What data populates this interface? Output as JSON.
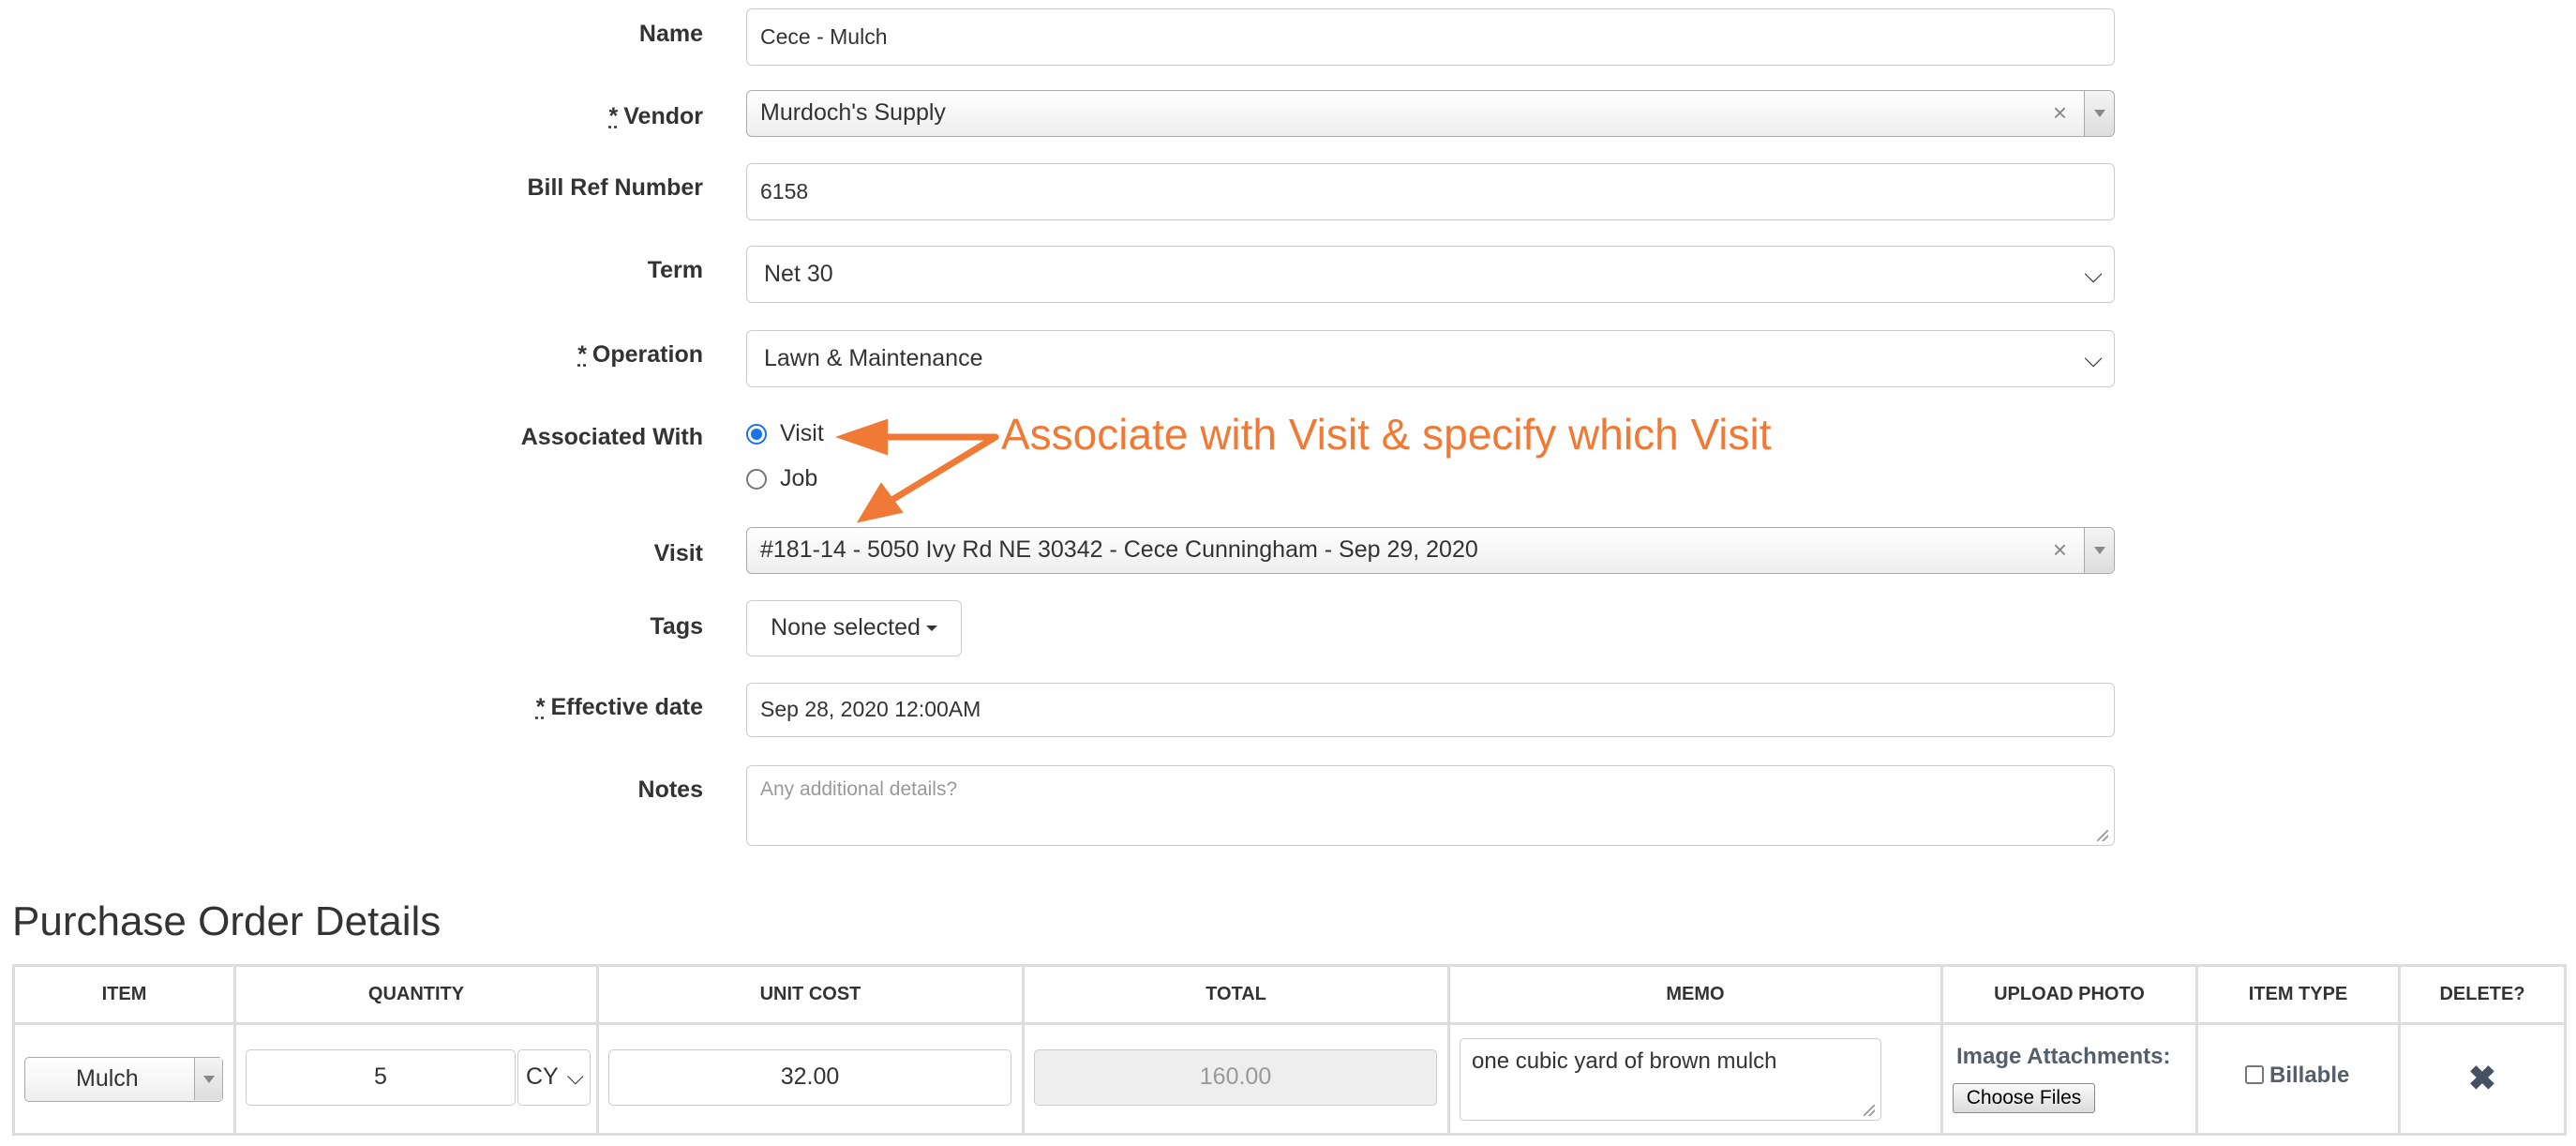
{
  "form": {
    "name": {
      "label": "Name",
      "value": "Cece - Mulch"
    },
    "vendor": {
      "required": "*",
      "label": "Vendor",
      "value": "Murdoch's Supply",
      "clear": "×"
    },
    "bill_ref": {
      "label": "Bill Ref Number",
      "value": "6158"
    },
    "term": {
      "label": "Term",
      "value": "Net 30"
    },
    "operation": {
      "required": "*",
      "label": "Operation",
      "value": "Lawn & Maintenance"
    },
    "associated_with": {
      "label": "Associated With",
      "options": [
        {
          "label": "Visit",
          "checked": true
        },
        {
          "label": "Job",
          "checked": false
        }
      ]
    },
    "visit": {
      "label": "Visit",
      "value": "#181-14 - 5050 Ivy Rd NE 30342 - Cece Cunningham - Sep 29, 2020",
      "clear": "×"
    },
    "tags": {
      "label": "Tags",
      "value": "None selected"
    },
    "effective_date": {
      "required": "*",
      "label": "Effective date",
      "value": "Sep 28, 2020 12:00AM"
    },
    "notes": {
      "label": "Notes",
      "placeholder": "Any additional details?"
    }
  },
  "annotation": {
    "text": "Associate with Visit & specify which Visit",
    "color": "#f07a35"
  },
  "purchase_order": {
    "title": "Purchase Order Details",
    "columns": [
      "ITEM",
      "QUANTITY",
      "UNIT COST",
      "TOTAL",
      "MEMO",
      "UPLOAD PHOTO",
      "ITEM TYPE",
      "DELETE?"
    ],
    "rows": [
      {
        "item": "Mulch",
        "quantity": "5",
        "unit": "CY",
        "unit_cost": "32.00",
        "total": "160.00",
        "memo": "one cubic yard of brown mulch",
        "upload_label": "Image Attachments:",
        "upload_button": "Choose Files",
        "item_type": "Billable",
        "delete_icon": "✖"
      }
    ]
  },
  "icons": {
    "dropdown": "chevron-down-icon",
    "delete": "close-x-icon",
    "clear": "clear-x-icon"
  }
}
